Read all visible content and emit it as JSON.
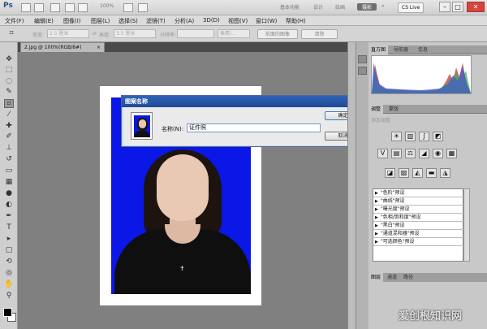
{
  "titlebar": {
    "logo": "Ps",
    "zoom": "100%",
    "workspaces": [
      "基本功能",
      "设计",
      "绘画",
      "摄影"
    ],
    "active_workspace": "摄影",
    "cs_live": "CS Live",
    "minimize": "–",
    "maximize": "□",
    "close": "✕"
  },
  "menubar": [
    "文件(F)",
    "编辑(E)",
    "图像(I)",
    "图层(L)",
    "选择(S)",
    "滤镜(T)",
    "分析(A)",
    "3D(D)",
    "视图(V)",
    "窗口(W)",
    "帮助(H)"
  ],
  "options": {
    "width_label": "宽度:",
    "height_label": "高度:",
    "resolution_label": "分辨率:",
    "width_value": "2.5 厘米",
    "height_value": "3.5 厘米",
    "unit_value": "像素/...",
    "front_image_button": "前面的图像",
    "clear_button": "清除"
  },
  "document_tab": {
    "title": "2.jpg @ 100%(RGB/8#)",
    "close": "×"
  },
  "dialog": {
    "title": "图案名称",
    "name_label": "名称(N):",
    "name_value": "证件照",
    "ok_button": "确定",
    "cancel_button": "取消",
    "close": "✕"
  },
  "panels": {
    "histogram_tabs": [
      "直方图",
      "导航器",
      "信息"
    ],
    "adjust_tabs": [
      "调整",
      "蒙版"
    ],
    "adjust_title": "添加调整",
    "presets": [
      "\"色阶\"预设",
      "\"曲线\"预设",
      "\"曝光度\"预设",
      "\"色相/饱和度\"预设",
      "\"黑白\"预设",
      "\"通道混和器\"预设",
      "\"可选颜色\"预设"
    ],
    "layers_tabs": [
      "图层",
      "通道",
      "路径"
    ]
  },
  "watermark": "爱创根知识网",
  "colors": {
    "photo_bg": "#0a17e6",
    "dialog_title": "#2f63b8"
  }
}
